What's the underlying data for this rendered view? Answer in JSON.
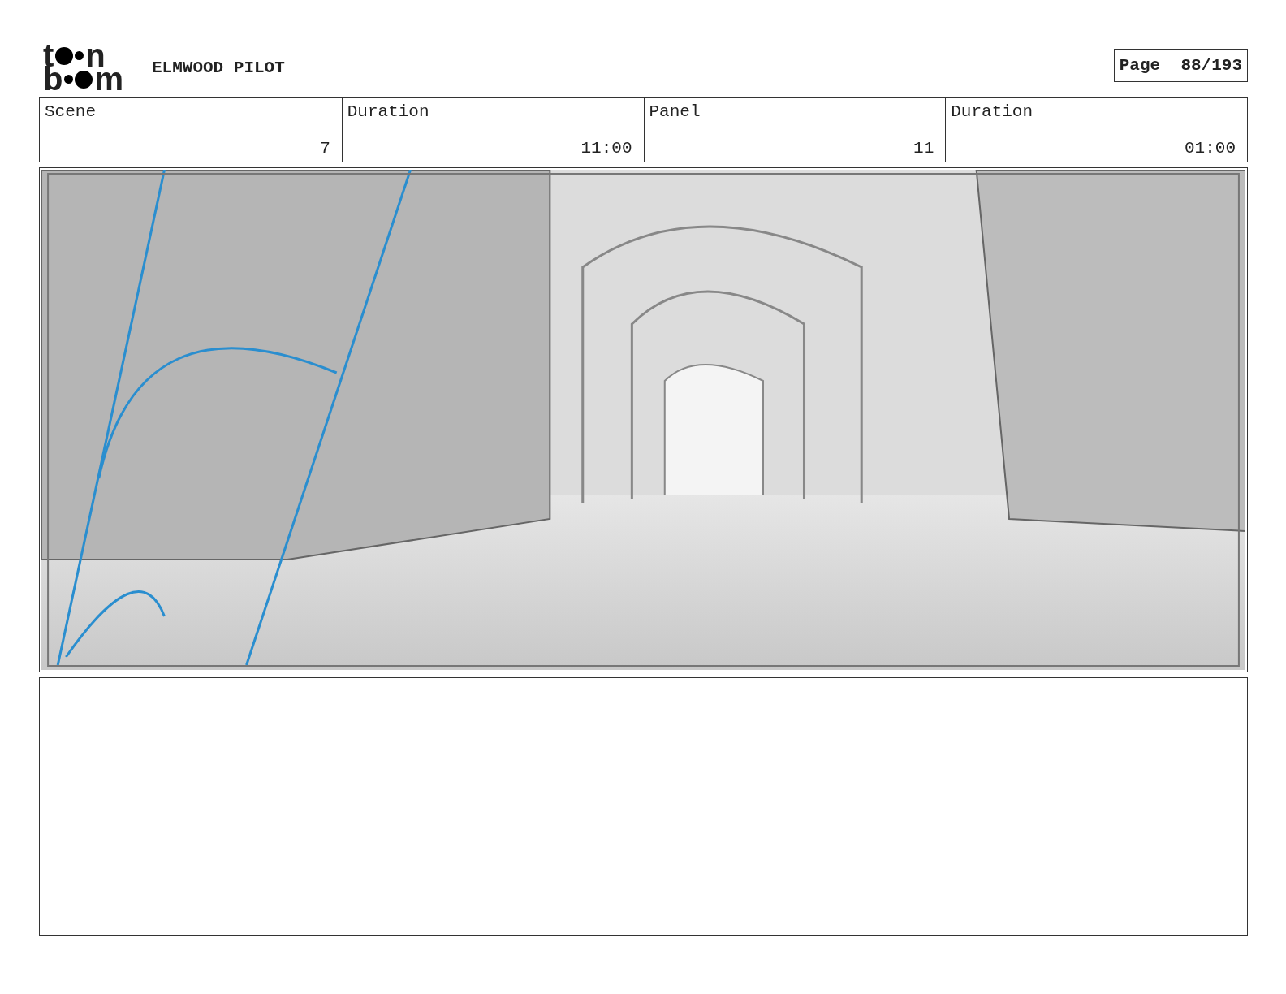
{
  "logo": {
    "top": [
      "t",
      "n"
    ],
    "bottom": [
      "b",
      "m"
    ]
  },
  "title": "ELMWOOD PILOT",
  "page": {
    "label": "Page",
    "value": "88/193"
  },
  "fields": [
    {
      "label": "Scene",
      "value": "7"
    },
    {
      "label": "Duration",
      "value": "11:00"
    },
    {
      "label": "Panel",
      "value": "11"
    },
    {
      "label": "Duration",
      "value": "01:00"
    }
  ]
}
